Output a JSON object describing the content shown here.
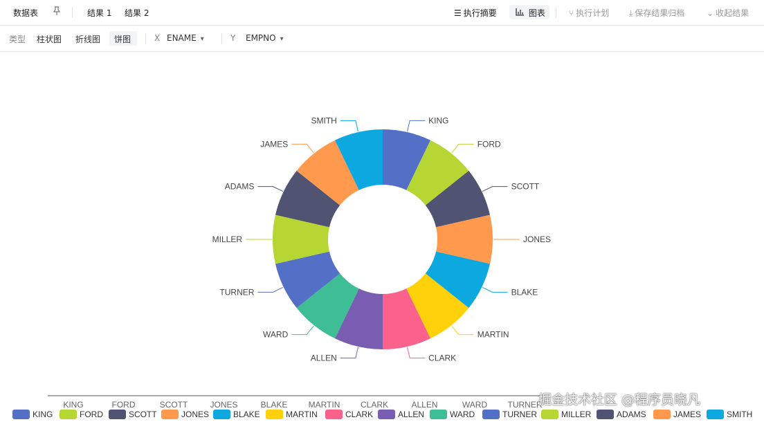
{
  "topbar": {
    "data_table": "数据表",
    "pin_icon": "pin-icon",
    "result1": "结果 1",
    "result2": "结果 2",
    "exec_summary": "执行摘要",
    "chart": "图表",
    "exec_plan": "执行计划",
    "save_archive": "保存结果归档",
    "collapse": "收起结果"
  },
  "subbar": {
    "type_label": "类型",
    "bar": "柱状图",
    "line": "折线图",
    "pie": "饼图",
    "x_label": "X",
    "x_field": "ENAME",
    "y_label": "Y",
    "y_field": "EMPNO"
  },
  "watermark": "掘金技术社区 @程序员晓凡",
  "colors": {
    "palette": [
      "#5470c6",
      "#b6d634",
      "#505372",
      "#ff994d",
      "#0ca8df",
      "#ffd10a",
      "#fb628b",
      "#785db0",
      "#3fbe95"
    ]
  },
  "chart_data": {
    "type": "pie",
    "style": "donut",
    "title": "",
    "categories": [
      "KING",
      "FORD",
      "SCOTT",
      "JONES",
      "BLAKE",
      "MARTIN",
      "CLARK",
      "ALLEN",
      "WARD",
      "TURNER",
      "MILLER",
      "ADAMS",
      "JAMES",
      "SMITH"
    ],
    "series": [
      {
        "name": "EMPNO",
        "values": [
          1,
          1,
          1,
          1,
          1,
          1,
          1,
          1,
          1,
          1,
          1,
          1,
          1,
          1
        ]
      }
    ],
    "colors": [
      "#5470c6",
      "#b6d634",
      "#505372",
      "#ff994d",
      "#0ca8df",
      "#ffd10a",
      "#fb628b",
      "#785db0",
      "#3fbe95",
      "#5470c6",
      "#b6d634",
      "#505372",
      "#ff994d",
      "#0ca8df"
    ],
    "legend_position": "bottom",
    "x_tick_labels": [
      "KING",
      "FORD",
      "SCOTT",
      "JONES",
      "BLAKE",
      "MARTIN",
      "CLARK",
      "ALLEN",
      "WARD",
      "TURNER"
    ]
  }
}
